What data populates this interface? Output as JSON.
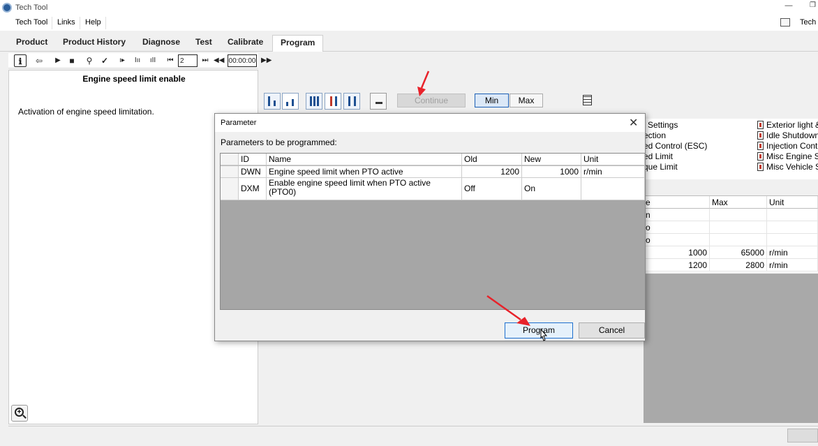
{
  "window": {
    "title": "Tech Tool",
    "right_label": "Tech"
  },
  "menu": [
    "Tech Tool",
    "Links",
    "Help"
  ],
  "tabs": [
    {
      "label": "Product",
      "active": false
    },
    {
      "label": "Product History",
      "active": false
    },
    {
      "label": "Diagnose",
      "active": false
    },
    {
      "label": "Test",
      "active": false
    },
    {
      "label": "Calibrate",
      "active": false
    },
    {
      "label": "Program",
      "active": true
    }
  ],
  "toolbar": {
    "step_value": "2",
    "time_value": "00:00:00"
  },
  "left_panel": {
    "heading": "Engine speed limit enable",
    "description": "Activation of engine speed limitation."
  },
  "right_panel": {
    "continue_label": "Continue",
    "min_label": "Min",
    "max_label": "Max",
    "categories_left": [
      "Settings",
      "ection",
      "ed Control (ESC)",
      "ed Limit",
      "que Limit"
    ],
    "categories_right": [
      "Exterior light &",
      "Idle Shutdown",
      "Injection Contr",
      "Misc Engine S",
      "Misc Vehicle S"
    ],
    "table": {
      "headers": [
        "e",
        "Max",
        "Unit"
      ],
      "rows": [
        [
          "n",
          "",
          ""
        ],
        [
          "o",
          "",
          ""
        ],
        [
          "o",
          "",
          ""
        ],
        [
          "1000",
          "65000",
          "r/min"
        ],
        [
          "1200",
          "2800",
          "r/min"
        ]
      ]
    }
  },
  "dialog": {
    "title": "Parameter",
    "label": "Parameters to be programmed:",
    "columns": [
      "ID",
      "Name",
      "Old",
      "New",
      "Unit"
    ],
    "rows": [
      {
        "id": "DWN",
        "name": "Engine speed limit when PTO active",
        "old": "1200",
        "new": "1000",
        "unit": "r/min"
      },
      {
        "id": "DXM",
        "name": "Enable engine speed limit when PTO active (PTO0)",
        "old": "Off",
        "new": "On",
        "unit": ""
      }
    ],
    "program_label": "Program",
    "cancel_label": "Cancel"
  },
  "colors": {
    "accent": "#1c6fcf",
    "annotation_arrow": "#e8222a",
    "program_gray": "#a6a6a6"
  }
}
